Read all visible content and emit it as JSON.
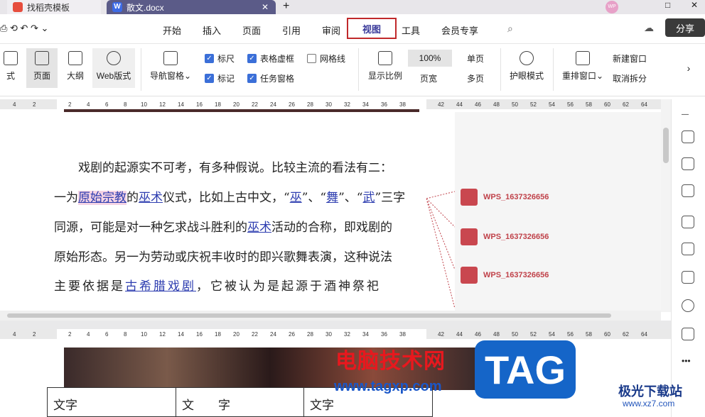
{
  "tabs": [
    {
      "label": "找稻壳模板"
    },
    {
      "label": "散文.docx",
      "icon": "W"
    }
  ],
  "menu": {
    "items": [
      "开始",
      "插入",
      "页面",
      "引用",
      "审阅",
      "视图",
      "工具",
      "会员专享"
    ],
    "share": "分享"
  },
  "ribbon": {
    "left_cut": "式",
    "row1": [
      "页面",
      "大纲",
      "Web版式"
    ],
    "nav": "导航窗格",
    "checks": [
      {
        "label": "标尺",
        "on": true
      },
      {
        "label": "表格虚框",
        "on": true
      },
      {
        "label": "网格线",
        "on": false
      },
      {
        "label": "标记",
        "on": true
      },
      {
        "label": "任务窗格",
        "on": true
      }
    ],
    "scale": "显示比例",
    "zoom": "100%",
    "single": "单页",
    "pagewidth": "页宽",
    "multi": "多页",
    "eye": "护眼模式",
    "rearrange": "重排窗口",
    "newwin": "新建窗口",
    "split": "取消拆分"
  },
  "ruler_top": [
    "4",
    "2",
    "2",
    "4",
    "6",
    "8",
    "10",
    "12",
    "14",
    "16",
    "18",
    "20",
    "22",
    "24",
    "26",
    "28",
    "30",
    "32",
    "34",
    "36",
    "38",
    "42",
    "44",
    "46",
    "48",
    "50",
    "52",
    "54",
    "56",
    "58",
    "60",
    "62",
    "64"
  ],
  "doc": {
    "l1": "戏剧的起源实不可考，有多种假说。比较主流的看法有二：",
    "l2a": "一为",
    "l2link1": "原始宗教",
    "l2b": "的",
    "l2link2": "巫术",
    "l2c": "仪式，比如上古中文，“",
    "l2link3": "巫",
    "l2d": "”、“",
    "l2link4": "舞",
    "l2e": "”、“",
    "l2link5": "武",
    "l2f": "”三字",
    "l3a": "同源，可能是对一种乞求战斗胜利的",
    "l3link": "巫术",
    "l3b": "活动的合称，即戏剧的",
    "l4": "原始形态。另一为劳动或庆祝丰收时的即兴歌舞表演，这种说法",
    "l5a": "主要依据是",
    "l5link": "古希腊戏剧",
    "l5b": "，它被认为是起源于酒神祭祀"
  },
  "comments": [
    "WPS_1637326656",
    "WPS_1637326656",
    "WPS_1637326656"
  ],
  "table": [
    "文字",
    "文　　字",
    "文字"
  ],
  "watermark": {
    "cn": "电脑技术网",
    "url": "www.tagxp.com",
    "tag": "TAG",
    "jg": "极光下载站",
    "jgurl": "www.xz7.com"
  }
}
